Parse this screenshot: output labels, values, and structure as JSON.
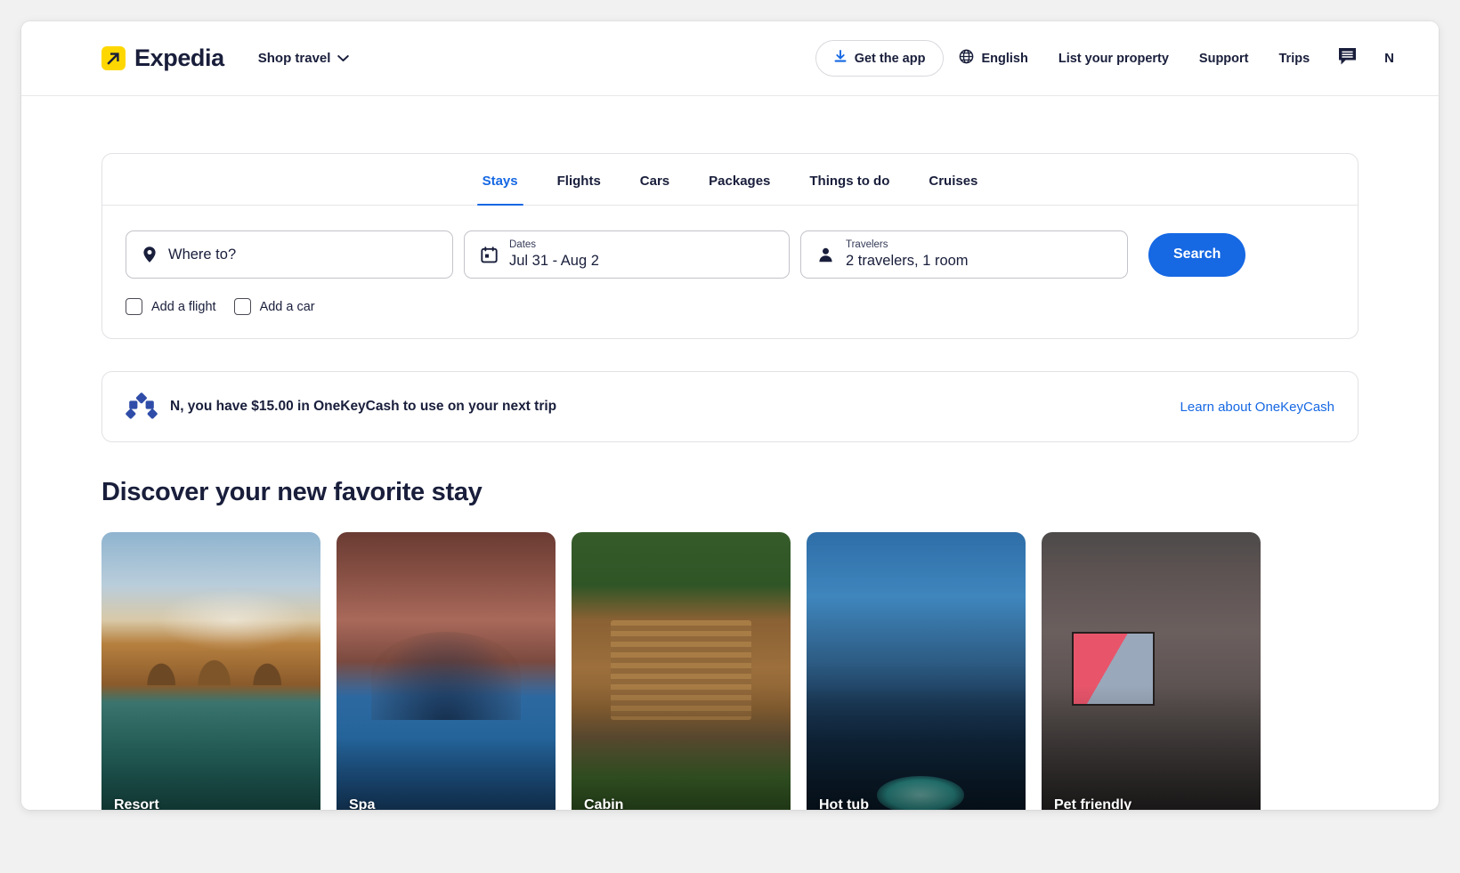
{
  "header": {
    "brand_name": "Expedia",
    "brand_icon": "expedia-arrow-logo",
    "shop_travel_label": "Shop travel",
    "shop_travel_icon": "chevron-down-icon",
    "get_app_label": "Get the app",
    "get_app_icon": "download-icon",
    "language_label": "English",
    "language_icon": "globe-icon",
    "list_property_label": "List your property",
    "support_label": "Support",
    "trips_label": "Trips",
    "messages_icon": "chat-bubble-icon",
    "avatar_initial": "N"
  },
  "search": {
    "tabs": [
      {
        "label": "Stays",
        "active": true
      },
      {
        "label": "Flights",
        "active": false
      },
      {
        "label": "Cars",
        "active": false
      },
      {
        "label": "Packages",
        "active": false
      },
      {
        "label": "Things to do",
        "active": false
      },
      {
        "label": "Cruises",
        "active": false
      }
    ],
    "destination": {
      "icon": "location-pin-icon",
      "placeholder": "Where to?",
      "value": ""
    },
    "dates": {
      "icon": "calendar-icon",
      "label": "Dates",
      "value": "Jul 31 - Aug 2"
    },
    "travelers": {
      "icon": "person-icon",
      "label": "Travelers",
      "value": "2 travelers, 1 room"
    },
    "search_button_label": "Search",
    "add_flight_label": "Add a flight",
    "add_car_label": "Add a car"
  },
  "onekey": {
    "icon": "one-key-diamonds-icon",
    "message": "N, you have $15.00 in OneKeyCash to use on your next trip",
    "link_label": "Learn about OneKeyCash"
  },
  "discover": {
    "title": "Discover your new favorite stay",
    "cards": [
      {
        "label": "Resort",
        "image": "resort-pool-arches"
      },
      {
        "label": "Spa",
        "image": "spa-vaulted-indoor-pool"
      },
      {
        "label": "Cabin",
        "image": "log-cabin-in-woods"
      },
      {
        "label": "Hot tub",
        "image": "hot-tub-palms-dusk"
      },
      {
        "label": "Pet friendly",
        "image": "pet-friendly-lounge"
      }
    ]
  },
  "colors": {
    "brand_yellow": "#ffd700",
    "accent_blue": "#1668e3",
    "text_dark": "#191e3b",
    "onekey_blue": "#2f4da8"
  }
}
